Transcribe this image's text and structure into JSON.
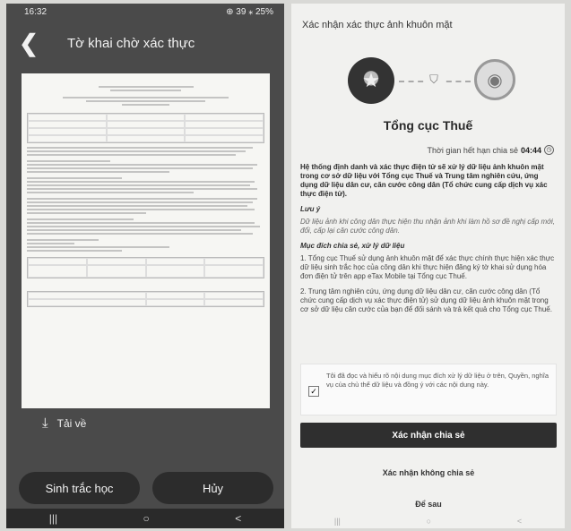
{
  "left": {
    "status": {
      "time": "16:32",
      "right": "⊕ 39 ⁎ 25%"
    },
    "appbar": {
      "back": "❮",
      "title": "Tờ khai chờ xác thực"
    },
    "download_label": "Tải về",
    "buttons": {
      "biometric": "Sinh trắc học",
      "cancel": "Hủy"
    },
    "nav": [
      "|||",
      "○",
      "<"
    ]
  },
  "right": {
    "header": "Xác nhận xác thực ảnh khuôn mặt",
    "org": "Tổng cục Thuế",
    "timer": {
      "label": "Thời gian hết hạn chia sẻ",
      "value": "04:44"
    },
    "intro": "Hệ thống định danh và xác thực điện tử sẽ xử lý dữ liệu ảnh khuôn mặt trong cơ sở dữ liệu với Tổng cục Thuế và Trung tâm nghiên cứu, ứng dụng dữ liệu dân cư, căn cước công dân (Tổ chức cung cấp dịch vụ xác thực điện tử).",
    "note_title": "Lưu ý",
    "note_text": "Dữ liệu ảnh khi công dân thực hiện thu nhận ảnh khi làm hồ sơ đề nghị cấp mới, đổi, cấp lại căn cước công dân.",
    "purpose_title": "Mục đích chia sẻ, xử lý dữ liệu",
    "purpose_1": "1. Tổng cục Thuế sử dụng ảnh khuôn mặt để xác thực chính thực hiện xác thực dữ liệu sinh trắc học của công dân khi thực hiện đăng ký tờ khai sử dụng hóa đơn điện tử trên app eTax Mobile tại Tổng cục Thuế.",
    "purpose_2": "2. Trung tâm nghiên cứu, ứng dụng dữ liệu dân cư, căn cước công dân (Tổ chức cung cấp dịch vụ xác thực điện tử) sử dụng dữ liệu ảnh khuôn mặt trong cơ sở dữ liệu căn cước của bạn để đối sánh và trả kết quả cho Tổng cục Thuế.",
    "consent_text": "Tôi đã đọc và hiểu rõ nội dung mục đích xử lý dữ liệu ở trên, Quyền, nghĩa vụ của chủ thể dữ liệu và đồng ý với các nội dung này.",
    "btn_confirm": "Xác nhận chia sẻ",
    "btn_decline": "Xác nhận không chia sẻ",
    "btn_later": "Để sau",
    "nav": [
      "|||",
      "○",
      "<"
    ]
  }
}
